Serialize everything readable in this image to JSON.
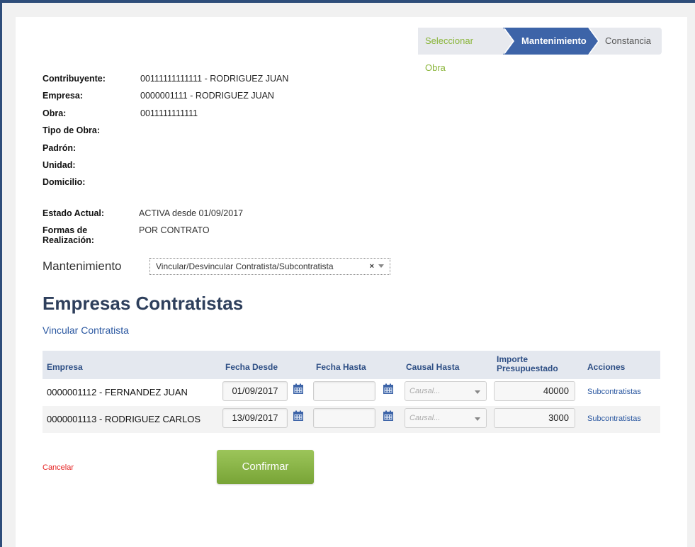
{
  "steps": [
    {
      "label": "Seleccionar Obra",
      "state": "done"
    },
    {
      "label": "Mantenimiento",
      "state": "active"
    },
    {
      "label": "Constancia",
      "state": "pending"
    }
  ],
  "info": {
    "contribuyente_label": "Contribuyente:",
    "contribuyente_value": "00111111111111 -  RODRIGUEZ JUAN",
    "empresa_label": "Empresa:",
    "empresa_value": "0000001111 - RODRIGUEZ JUAN",
    "obra_label": "Obra:",
    "obra_value": "0011111111111",
    "tipo_obra_label": "Tipo de Obra:",
    "padron_label": "Padrón:",
    "unidad_label": "Unidad:",
    "domicilio_label": "Domicilio:"
  },
  "status": {
    "estado_label": "Estado Actual:",
    "estado_value": "ACTIVA desde 01/09/2017",
    "formas_label": "Formas de Realización:",
    "formas_value": "POR CONTRATO"
  },
  "mantenimiento": {
    "label": "Mantenimiento",
    "selected": "Vincular/Desvincular Contratista/Subcontratista",
    "clear": "×"
  },
  "section_title": "Empresas Contratistas",
  "vincular_link": "Vincular Contratista",
  "table": {
    "headers": {
      "empresa": "Empresa",
      "fecha_desde": "Fecha Desde",
      "fecha_hasta": "Fecha Hasta",
      "causal_hasta": "Causal Hasta",
      "importe_1": "Importe",
      "importe_2": "Presupuestado",
      "acciones": "Acciones"
    },
    "rows": [
      {
        "empresa": "0000001112 - FERNANDEZ JUAN",
        "fecha_desde": "01/09/2017",
        "fecha_hasta": "",
        "causal_placeholder": "Causal...",
        "importe": "40000",
        "accion": "Subcontratistas"
      },
      {
        "empresa": "0000001113 - RODRIGUEZ CARLOS",
        "fecha_desde": "13/09/2017",
        "fecha_hasta": "",
        "causal_placeholder": "Causal...",
        "importe": "3000",
        "accion": "Subcontratistas"
      }
    ]
  },
  "cancel_label": "Cancelar",
  "confirm_label": "Confirmar",
  "colors": {
    "primary_blue": "#3d64a8",
    "step_done_green": "#8ab53a",
    "confirm_green": "#8ab848",
    "cancel_red": "#e52222",
    "header_bg": "#e4e8ef"
  }
}
